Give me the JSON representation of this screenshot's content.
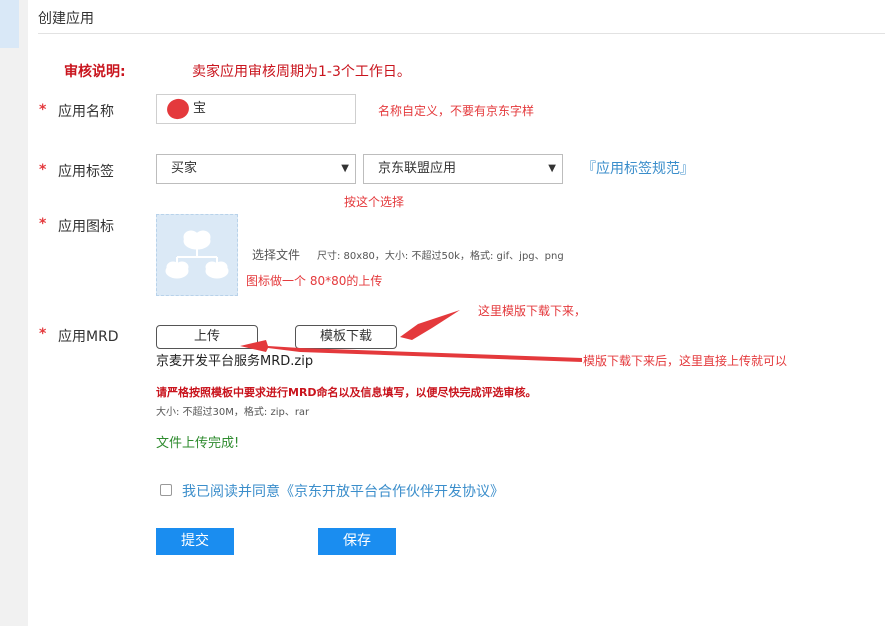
{
  "page_title": "创建应用",
  "review": {
    "label": "审核说明:",
    "text": "卖家应用审核周期为1-3个工作日。"
  },
  "required_mark": "*",
  "app_name": {
    "label": "应用名称",
    "value": "宝",
    "note": "名称自定义，不要有京东字样"
  },
  "app_tag": {
    "label": "应用标签",
    "select1": "买家",
    "select2": "京东联盟应用",
    "link": "『应用标签规范』",
    "note": "按这个选择"
  },
  "app_icon": {
    "label": "应用图标",
    "choose_file": "选择文件",
    "hint": "尺寸: 80x80，大小: 不超过50k，格式: gif、jpg、png",
    "note": "图标做一个  80*80的上传"
  },
  "mrd": {
    "label": "应用MRD",
    "upload_button": "上传",
    "template_button": "模板下载",
    "filename": "京麦开发平台服务MRD.zip",
    "warning": "请严格按照模板中要求进行MRD命名以及信息填写，以便尽快完成评选审核。",
    "limits": "大小: 不超过30M，格式: zip、rar",
    "status": "文件上传完成!",
    "note_download": "这里模版下载下来，",
    "note_upload": "模版下载下来后，这里直接上传就可以"
  },
  "agreement": {
    "text": "我已阅读并同意《京东开放平台合作伙伴开发协议》",
    "checked": false
  },
  "buttons": {
    "submit": "提交",
    "save": "保存"
  },
  "colors": {
    "primary_button": "#1a8df0",
    "required": "#e4393c",
    "link": "#3b8ecb",
    "success": "#2e8b2e",
    "annotation": "#e4393c"
  }
}
